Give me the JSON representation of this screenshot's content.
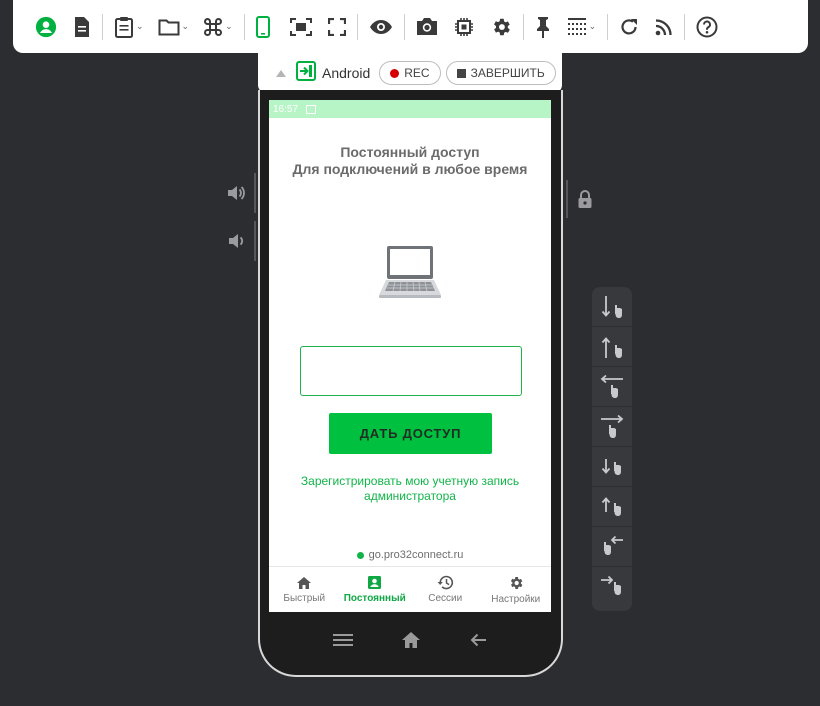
{
  "toolbar": {
    "icons": [
      "account-icon",
      "file-icon",
      "clipboard-icon",
      "folder-icon",
      "command-icon",
      "phone-icon",
      "fit-screen-icon",
      "fullscreen-icon",
      "eye-icon",
      "camera-icon",
      "chip-icon",
      "gear-icon",
      "pin-icon",
      "grid-icon",
      "refresh-icon",
      "rss-icon",
      "help-icon"
    ],
    "accent": "#00b140"
  },
  "device_bar": {
    "platform_label": "Android",
    "rec_label": "REC",
    "finish_label": "ЗАВЕРШИТЬ"
  },
  "screen": {
    "status_time": "16:57",
    "title_line1": "Постоянный доступ",
    "title_line2": "Для подключений в любое время",
    "input_value": "",
    "grant_button": "ДАТЬ ДОСТУП",
    "register_link": "Зарегистрировать мою учетную запись администратора",
    "server": "go.pro32connect.ru",
    "nav": [
      {
        "label": "Быстрый",
        "icon": "home-icon"
      },
      {
        "label": "Постоянный",
        "icon": "contact-icon"
      },
      {
        "label": "Сессии",
        "icon": "history-icon"
      },
      {
        "label": "Настройки",
        "icon": "gear-icon"
      }
    ],
    "active_nav": "Постоянный"
  },
  "gestures": [
    "swipe-down-icon",
    "swipe-up-icon",
    "swipe-left-icon",
    "swipe-right-icon",
    "short-swipe-down-icon",
    "short-swipe-up-icon",
    "short-swipe-left-icon",
    "short-swipe-right-icon"
  ]
}
